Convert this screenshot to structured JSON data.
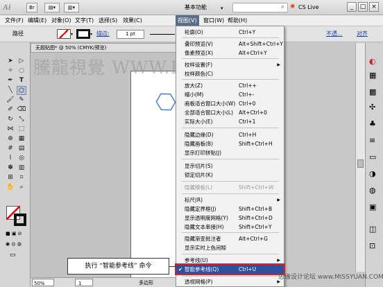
{
  "titlebar": {
    "app_logo": "Ai",
    "bridge_button": "Br",
    "workspace": "基本功能",
    "cs_live": "CS Live",
    "win_minimize": "_",
    "win_maximize": "□",
    "win_close": "×"
  },
  "menubar": {
    "items": [
      "文件(F)",
      "编辑(E)",
      "对象(O)",
      "文字(T)",
      "选择(S)",
      "效果(C)",
      "视图(V)",
      "窗口(W)",
      "帮助(H)"
    ]
  },
  "controlbar": {
    "label": "路径",
    "stroke_label": "描边:",
    "stroke_value": "1 pt",
    "opacity_label": "不透...",
    "align_label": "对齐"
  },
  "document": {
    "tab_title": "无题贴图* @ 50% (CMYK/预览)",
    "zoom": "50%",
    "page": "1",
    "status": "多边形"
  },
  "watermark": "騰龍視覺 WWW.LVI.NET",
  "dropdown": {
    "items": [
      {
        "label": "轮廓(O)",
        "shortcut": "Ctrl+Y"
      },
      {
        "label": "叠印预览(V)",
        "shortcut": "Alt+Shift+Ctrl+Y"
      },
      {
        "label": "像素预览(X)",
        "shortcut": "Alt+Ctrl+Y"
      },
      {
        "label": "校样设置(F)",
        "shortcut": "",
        "submenu": true
      },
      {
        "label": "校样颜色(C)",
        "shortcut": ""
      },
      {
        "label": "放大(Z)",
        "shortcut": "Ctrl++"
      },
      {
        "label": "缩小(M)",
        "shortcut": "Ctrl+-"
      },
      {
        "label": "画板适合窗口大小(W)",
        "shortcut": "Ctrl+0"
      },
      {
        "label": "全部适合窗口大小(L)",
        "shortcut": "Alt+Ctrl+0"
      },
      {
        "label": "实际大小(E)",
        "shortcut": "Ctrl+1"
      },
      {
        "label": "隐藏边缘(D)",
        "shortcut": "Ctrl+H"
      },
      {
        "label": "隐藏画板(B)",
        "shortcut": "Shift+Ctrl+H"
      },
      {
        "label": "显示打印拼贴(J)",
        "shortcut": ""
      },
      {
        "label": "显示切片(S)",
        "shortcut": ""
      },
      {
        "label": "锁定切片(K)",
        "shortcut": ""
      },
      {
        "label": "隐藏模板(L)",
        "shortcut": "Shift+Ctrl+W",
        "disabled": true
      },
      {
        "label": "标尺(R)",
        "shortcut": "",
        "submenu": true
      },
      {
        "label": "隐藏定界框(J)",
        "shortcut": "Shift+Ctrl+B"
      },
      {
        "label": "显示透明度网格(Y)",
        "shortcut": "Shift+Ctrl+D"
      },
      {
        "label": "隐藏文本串接(H)",
        "shortcut": "Shift+Ctrl+Y"
      },
      {
        "label": "隐藏渐变批注者",
        "shortcut": "Alt+Ctrl+G"
      },
      {
        "label": "显示实时上色间隙",
        "shortcut": ""
      },
      {
        "label": "参考线(U)",
        "shortcut": "",
        "submenu": true
      },
      {
        "label": "智能参考线(Q)",
        "shortcut": "Ctrl+U",
        "checked": true,
        "highlighted": true
      },
      {
        "label": "透视网格(P)",
        "shortcut": "",
        "submenu": true
      }
    ]
  },
  "callout": "执行 “智能参考线” 命令",
  "site_watermark": "思缘设计论坛 www.MISSYUAN.COM",
  "colors": {
    "highlight": "#2d4f9e",
    "callout_border": "#e02020"
  }
}
